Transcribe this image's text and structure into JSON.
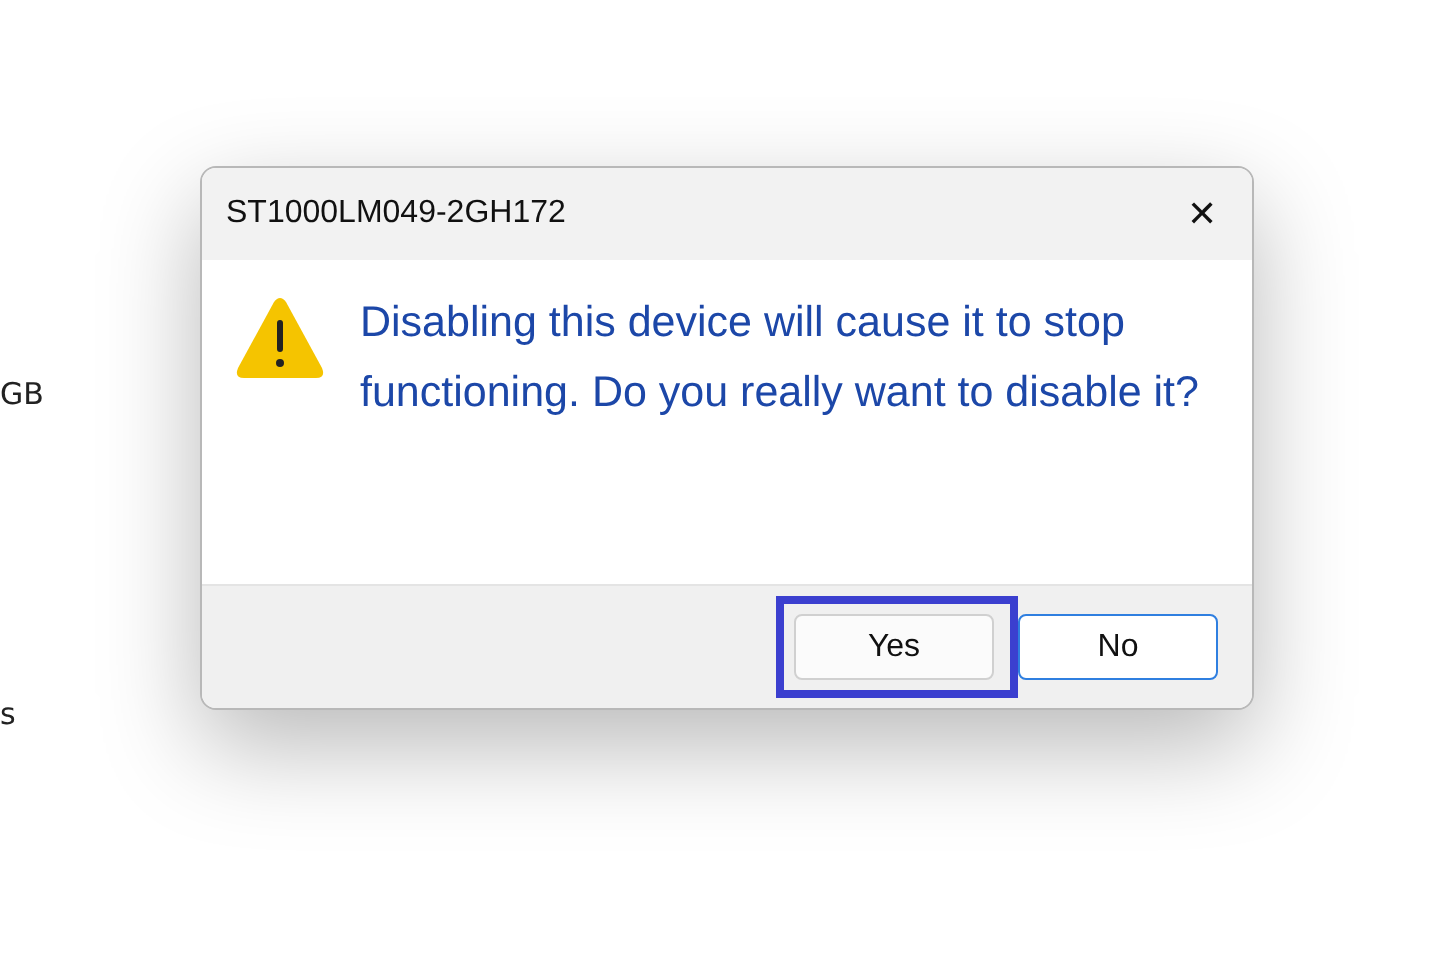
{
  "background": {
    "texts": [
      "GB",
      "s"
    ]
  },
  "dialog": {
    "title": "ST1000LM049-2GH172",
    "close": "✕",
    "message": "Disabling this device will cause it to stop functioning. Do you really want to disable it?",
    "buttons": [
      {
        "label": "Yes",
        "focused": false,
        "highlighted": true
      },
      {
        "label": "No",
        "focused": true,
        "highlighted": false
      }
    ]
  }
}
